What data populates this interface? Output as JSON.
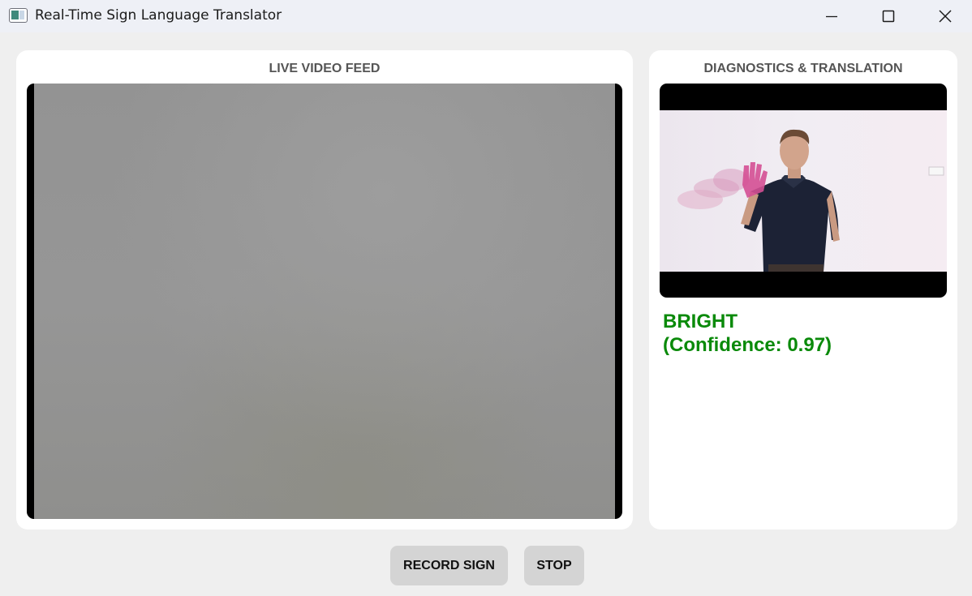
{
  "window": {
    "title": "Real-Time Sign Language Translator",
    "controls": [
      "minimize-icon",
      "maximize-icon",
      "close-icon"
    ]
  },
  "live_panel": {
    "heading": "LIVE VIDEO FEED"
  },
  "diagnostics_panel": {
    "heading": "DIAGNOSTICS & TRANSLATION",
    "prediction": "BRIGHT",
    "confidence_text": "(Confidence: 0.97)",
    "prediction_color": "#0a8a0a"
  },
  "controls": {
    "record_label": "RECORD SIGN",
    "stop_label": "STOP"
  }
}
